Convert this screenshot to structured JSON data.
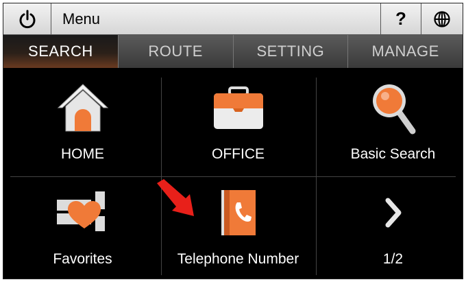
{
  "topbar": {
    "title": "Menu",
    "help_label": "?",
    "power_icon": "power-icon",
    "globe_icon": "globe-icon"
  },
  "tabs": [
    {
      "label": "SEARCH",
      "active": true
    },
    {
      "label": "ROUTE",
      "active": false
    },
    {
      "label": "SETTING",
      "active": false
    },
    {
      "label": "MANAGE",
      "active": false
    }
  ],
  "grid": {
    "items": [
      {
        "label": "HOME",
        "icon": "home-icon"
      },
      {
        "label": "OFFICE",
        "icon": "briefcase-icon"
      },
      {
        "label": "Basic Search",
        "icon": "magnifier-icon"
      },
      {
        "label": "Favorites",
        "icon": "heart-icon"
      },
      {
        "label": "Telephone Number",
        "icon": "phone-book-icon"
      },
      {
        "label": "1/2",
        "icon": "chevron-right-icon"
      }
    ]
  },
  "colors": {
    "accent": "#f07a38",
    "arrow": "#e8201a",
    "background": "#000000"
  }
}
